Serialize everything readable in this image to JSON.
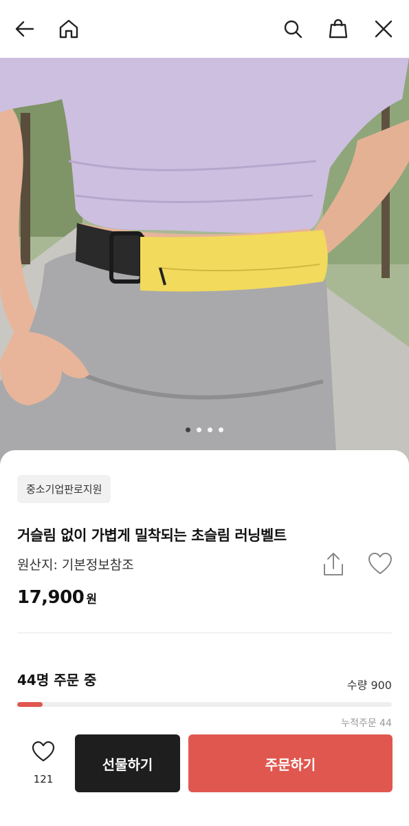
{
  "header": {
    "icons": [
      "back-arrow-icon",
      "home-icon",
      "search-icon",
      "shopping-bag-icon",
      "close-icon"
    ]
  },
  "gallery": {
    "image_description_icon": "product-photo",
    "page_count": 4,
    "active_page": 1
  },
  "product": {
    "badge": "중소기업판로지원",
    "title": "거슬림 없이 가볍게 밀착되는 초슬림 러닝벨트",
    "origin": "원산지: 기본정보참조",
    "price": "17,900",
    "currency": "원"
  },
  "orders": {
    "headline": "44명 주문 중",
    "quantity_label": "수량 900",
    "progress_fraction": 0.068,
    "cumulative_label": "누적주문 44"
  },
  "actions": {
    "like_count": "121",
    "gift_label": "선물하기",
    "order_label": "주문하기"
  },
  "colors": {
    "accent": "#e0574f",
    "dark_button": "#1e1e1e",
    "badge_bg": "#f1f1f1"
  }
}
